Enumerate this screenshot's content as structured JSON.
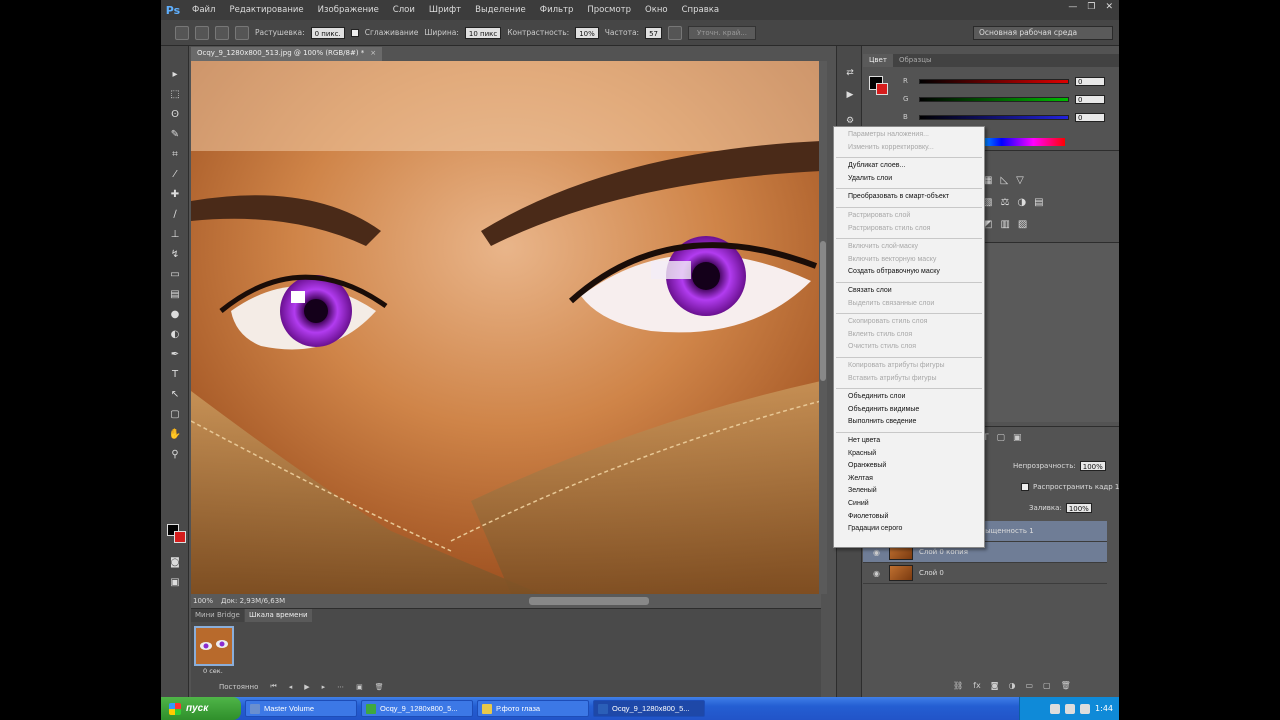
{
  "app": {
    "logo": "Ps",
    "menu": [
      "Файл",
      "Редактирование",
      "Изображение",
      "Слои",
      "Шрифт",
      "Выделение",
      "Фильтр",
      "Просмотр",
      "Окно",
      "Справка"
    ]
  },
  "options": {
    "feather_label": "Растушевка:",
    "feather_value": "0 пикс.",
    "antialias_label": "Сглаживание",
    "width_label": "Ширина:",
    "width_value": "10 пикс",
    "contrast_label": "Контрастность:",
    "contrast_value": "10%",
    "frequency_label": "Частота:",
    "frequency_value": "57",
    "refine_button": "Уточн. край...",
    "workspace": "Основная рабочая среда"
  },
  "document": {
    "tab_title": "Ocqy_9_1280x800_513.jpg @ 100% (RGB/8#) *",
    "status_zoom": "100%",
    "status_doc": "Док: 2,93M/6,63M"
  },
  "timeline": {
    "tab_mini": "Мини Bridge",
    "tab_timeline": "Шкала времени",
    "frame_number": "1",
    "frame_time": "0 сек.",
    "loop_mode": "Постоянно"
  },
  "panels": {
    "color_tab": "Цвет",
    "swatches_tab": "Образцы",
    "color_values": [
      "0",
      "0",
      "0"
    ],
    "opacity_label": "Непрозрачность:",
    "opacity_value": "100%",
    "propagate_label": "Распространить кадр 1",
    "fill_label": "Заливка:",
    "fill_value": "100%",
    "layers": [
      {
        "name": "Цветовой тон/Насыщенность 1",
        "selected": true
      },
      {
        "name": "Слой 0 копия",
        "selected": true
      },
      {
        "name": "Слой 0",
        "selected": false
      }
    ]
  },
  "context_menu": {
    "items": [
      {
        "label": "Параметры наложения...",
        "disabled": true
      },
      {
        "label": "Изменить корректировку...",
        "disabled": true
      },
      {
        "separator": true
      },
      {
        "label": "Дубликат слоев...",
        "disabled": false
      },
      {
        "label": "Удалить слои",
        "disabled": false
      },
      {
        "separator": true
      },
      {
        "label": "Преобразовать в смарт-объект",
        "disabled": false
      },
      {
        "separator": true
      },
      {
        "label": "Растрировать слой",
        "disabled": true
      },
      {
        "label": "Растрировать стиль слоя",
        "disabled": true
      },
      {
        "separator": true
      },
      {
        "label": "Включить слой-маску",
        "disabled": true
      },
      {
        "label": "Включить векторную маску",
        "disabled": true
      },
      {
        "label": "Создать обтравочную маску",
        "disabled": false
      },
      {
        "separator": true
      },
      {
        "label": "Связать слои",
        "disabled": false
      },
      {
        "label": "Выделить связанные слои",
        "disabled": true
      },
      {
        "separator": true
      },
      {
        "label": "Скопировать стиль слоя",
        "disabled": true
      },
      {
        "label": "Вклеить стиль слоя",
        "disabled": true
      },
      {
        "label": "Очистить стиль слоя",
        "disabled": true
      },
      {
        "separator": true
      },
      {
        "label": "Копировать атрибуты фигуры",
        "disabled": true
      },
      {
        "label": "Вставить атрибуты фигуры",
        "disabled": true
      },
      {
        "separator": true
      },
      {
        "label": "Объединить слои",
        "disabled": false
      },
      {
        "label": "Объединить видимые",
        "disabled": false
      },
      {
        "label": "Выполнить сведение",
        "disabled": false
      },
      {
        "separator": true
      },
      {
        "label": "Нет цвета",
        "disabled": false
      },
      {
        "label": "Красный",
        "disabled": false
      },
      {
        "label": "Оранжевый",
        "disabled": false
      },
      {
        "label": "Желтая",
        "disabled": false
      },
      {
        "label": "Зеленый",
        "disabled": false
      },
      {
        "label": "Синий",
        "disabled": false
      },
      {
        "label": "Фиолетовый",
        "disabled": false
      },
      {
        "label": "Градации серого",
        "disabled": false
      }
    ]
  },
  "taskbar": {
    "start": "пуск",
    "items": [
      {
        "label": "Master Volume",
        "color": "#6a8fcf"
      },
      {
        "label": "Ocqy_9_1280x800_5...",
        "color": "#3fa83f"
      },
      {
        "label": "Р.фото глаза",
        "color": "#e8c84a"
      },
      {
        "label": "Ocqy_9_1280x800_5...",
        "color": "#2b5fb8"
      }
    ],
    "clock": "1:44"
  },
  "colors": {
    "accent": "#5fb0ff",
    "foreground": "#000000",
    "background": "#d61d1d",
    "selection": "#6f7d96"
  }
}
